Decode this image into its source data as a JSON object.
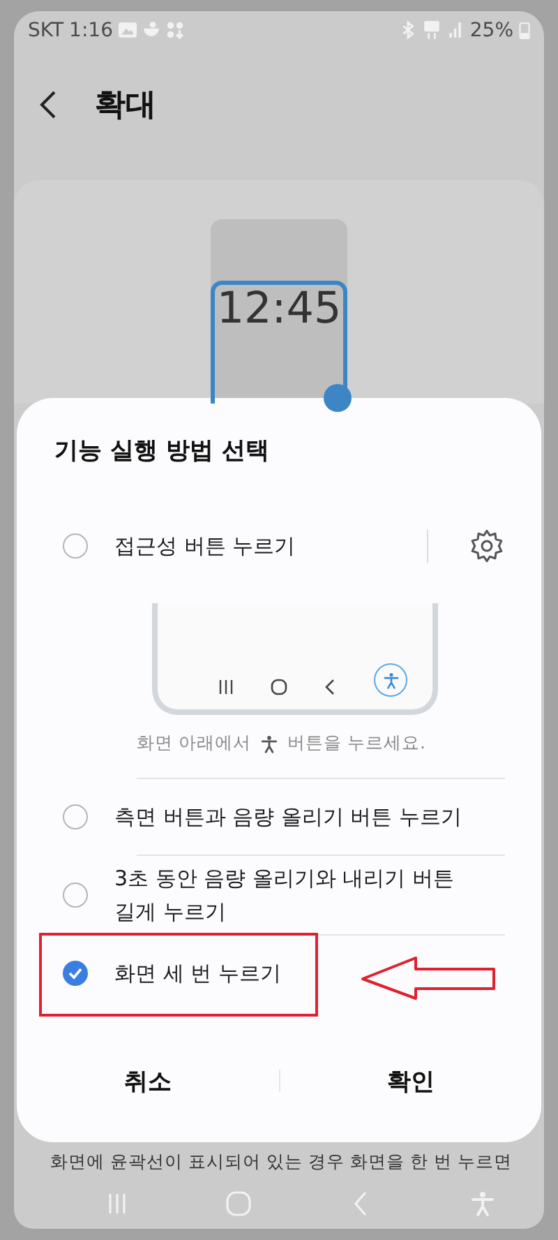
{
  "status_bar": {
    "carrier": "SKT",
    "time": "1:16",
    "battery": "25%"
  },
  "header": {
    "title": "확대"
  },
  "preview": {
    "clock": "12:45"
  },
  "dialog": {
    "title": "기능 실행 방법 선택",
    "options": [
      {
        "kind": "button",
        "label": "접근성 버튼 누르기",
        "selected": false,
        "highlighted": false,
        "hint_start": "화면 아래에서",
        "hint_end": "버튼을 누르세요."
      },
      {
        "kind": "plain",
        "label": "측면 버튼과 음량 올리기 버튼 누르기",
        "selected": false,
        "highlighted": false
      },
      {
        "kind": "plain",
        "label": "3초 동안 음량 올리기와 내리기 버튼 길게 누르기",
        "selected": false,
        "highlighted": false
      },
      {
        "kind": "plain",
        "label": "화면 세 번 누르기",
        "selected": true,
        "highlighted": true
      }
    ],
    "buttons": [
      "취소",
      "확인"
    ]
  },
  "footer_text": "화면에 윤곽선이 표시되어 있는 경우 화면을 한 번 누르면"
}
